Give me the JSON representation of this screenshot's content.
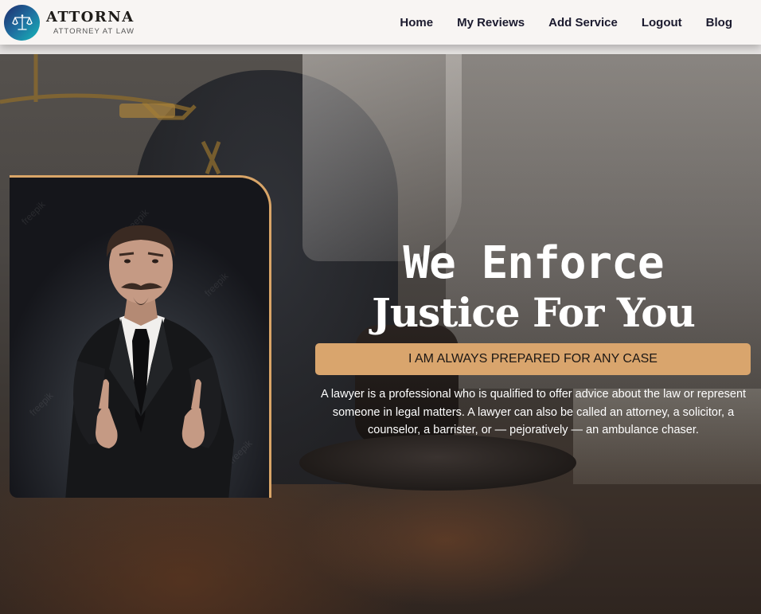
{
  "brand": {
    "name": "ATTORNA",
    "tagline": "ATTORNEY AT LAW",
    "logo_icon": "scales-of-justice-icon"
  },
  "nav": {
    "items": [
      {
        "label": "Home"
      },
      {
        "label": "My Reviews"
      },
      {
        "label": "Add Service"
      },
      {
        "label": "Logout"
      },
      {
        "label": "Blog"
      }
    ]
  },
  "hero": {
    "title_line1": "We Enforce",
    "title_line2": "Justice For You",
    "tagline": "I AM ALWAYS PREPARED FOR ANY CASE",
    "description": "A lawyer is a professional who is qualified to offer advice about the law or represent someone in legal matters. A lawyer can also be called an attorney, a solicitor, a counselor, a barrister, or — pejoratively — an ambulance chaser.",
    "portrait_watermark": "freepik"
  },
  "colors": {
    "accent": "#d9a56d",
    "header_bg": "#f8f5f3",
    "nav_text": "#1b1a2e",
    "logo_gradient": [
      "#1f2b6b",
      "#16b6b8"
    ]
  }
}
